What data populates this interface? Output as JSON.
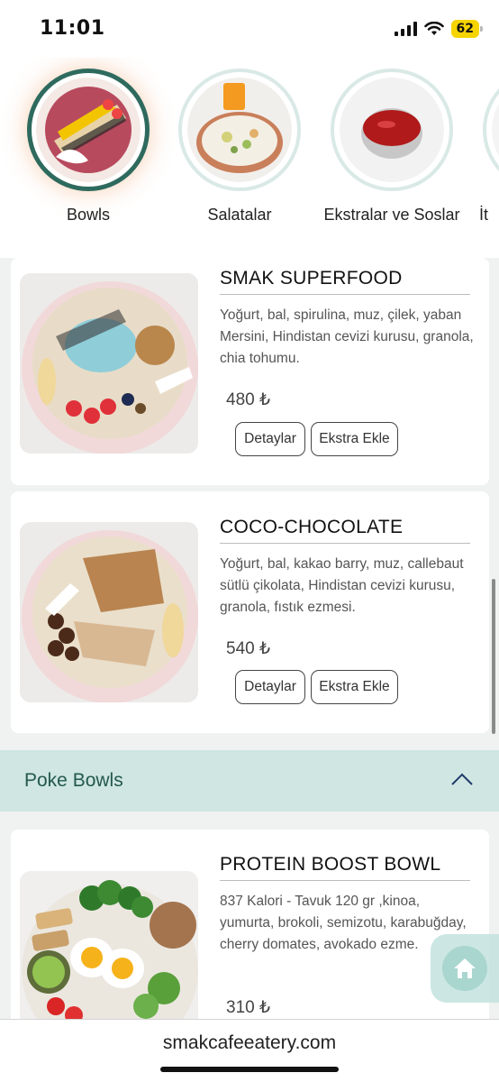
{
  "status": {
    "time": "11:01",
    "battery": "62"
  },
  "categories": [
    {
      "label": "Bowls",
      "active": true
    },
    {
      "label": "Salatalar",
      "active": false
    },
    {
      "label": "Ekstralar ve Soslar",
      "active": false
    },
    {
      "label": "İt",
      "active": false
    }
  ],
  "products": [
    {
      "title": "SMAK SUPERFOOD",
      "description": "Yoğurt, bal, spirulina, muz, çilek, yaban Mersini, Hindistan cevizi kurusu, granola, chia tohumu.",
      "price": "480 ₺",
      "details_label": "Detaylar",
      "extra_label": "Ekstra Ekle"
    },
    {
      "title": "COCO-CHOCOLATE",
      "description": "Yoğurt, bal, kakao barry, muz, callebaut sütlü çikolata, Hindistan cevizi kurusu, granola, fıstık ezmesi.",
      "price": "540 ₺",
      "details_label": "Detaylar",
      "extra_label": "Ekstra Ekle"
    },
    {
      "title": "PROTEIN BOOST BOWL",
      "description": "837 Kalori - Tavuk 120 gr ,kinoa, yumurta, brokoli, semizotu, karabuğday, cherry domates, avokado ezme.",
      "price": "310 ₺"
    }
  ],
  "section": {
    "title": "Poke Bowls"
  },
  "browser": {
    "url": "smakcafeeatery.com"
  },
  "colors": {
    "accent": "#2e6a5e",
    "section_bg": "#cfe6e2",
    "section_text": "#24584f"
  }
}
